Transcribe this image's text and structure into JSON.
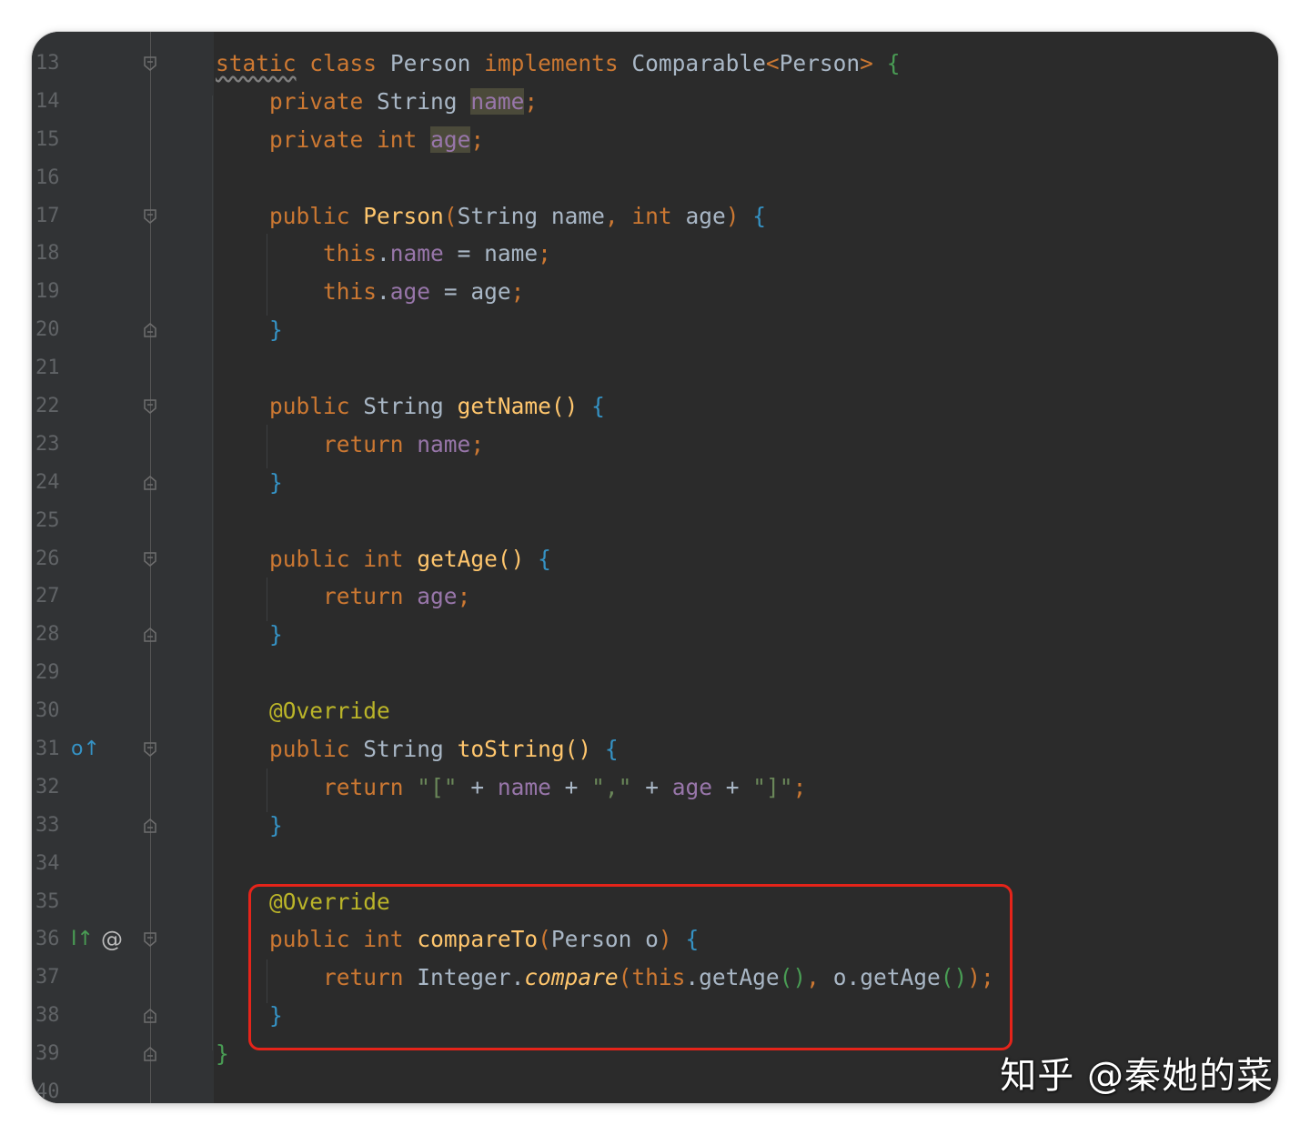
{
  "editor": {
    "theme_colors": {
      "background": "#2b2b2b",
      "gutter": "#313335",
      "keyword": "#cc7832",
      "function": "#ffc66d",
      "field": "#9876aa",
      "string": "#6a8759",
      "annotation": "#bbb529",
      "highlight_box": "#e5241a"
    },
    "lines": [
      {
        "num": "13"
      },
      {
        "num": "14"
      },
      {
        "num": "15"
      },
      {
        "num": "16"
      },
      {
        "num": "17"
      },
      {
        "num": "18"
      },
      {
        "num": "19"
      },
      {
        "num": "20"
      },
      {
        "num": "21"
      },
      {
        "num": "22"
      },
      {
        "num": "23"
      },
      {
        "num": "24"
      },
      {
        "num": "25"
      },
      {
        "num": "26"
      },
      {
        "num": "27"
      },
      {
        "num": "28"
      },
      {
        "num": "29"
      },
      {
        "num": "30"
      },
      {
        "num": "31"
      },
      {
        "num": "32"
      },
      {
        "num": "33"
      },
      {
        "num": "34"
      },
      {
        "num": "35"
      },
      {
        "num": "36"
      },
      {
        "num": "37"
      },
      {
        "num": "38"
      },
      {
        "num": "39"
      },
      {
        "num": "40"
      }
    ],
    "tokens": {
      "static": "static",
      "class": "class",
      "Person": "Person",
      "implements": "implements",
      "Comparable": "Comparable",
      "lt": "<",
      "gt": ">",
      "lbrace": "{",
      "rbrace": "}",
      "private": "private",
      "String": "String",
      "name": "name",
      "semi": ";",
      "int": "int",
      "age": "age",
      "public": "public",
      "lparen": "(",
      "rparen": ")",
      "comma": ",",
      "this": "this",
      "dot": ".",
      "eq": "=",
      "getName": "getName",
      "parens": "()",
      "return": "return",
      "getAge": "getAge",
      "override": "@Override",
      "toString": "toString",
      "str_open": "\"[\"",
      "plus": "+",
      "str_comma": "\",\"",
      "str_close": "\"]\"",
      "compareTo": "compareTo",
      "o": "o",
      "Integer": "Integer",
      "compare": "compare"
    },
    "gutter_icons": {
      "implements_marker": "o↑",
      "override_marker": "I↑",
      "at": "@"
    }
  },
  "watermark": "知乎 @秦她的菜"
}
